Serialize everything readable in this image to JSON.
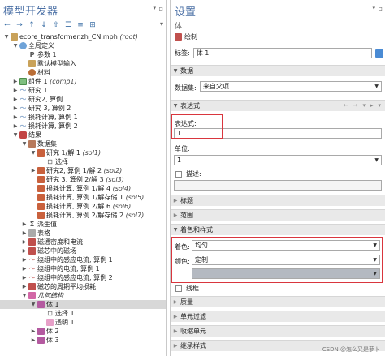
{
  "model_builder": {
    "title": "模型开发器",
    "tree": [
      {
        "label": "ecore_transformer.zh_CN.mph",
        "suffix": "(root)",
        "icon": "file-icon",
        "arrow": "▼",
        "depth": 0
      },
      {
        "label": "全局定义",
        "icon": "globe-icon",
        "arrow": "▼",
        "depth": 1
      },
      {
        "label": "参数 1",
        "icon": "param-icon",
        "arrow": "",
        "depth": 2
      },
      {
        "label": "默认模型输入",
        "icon": "doc-icon",
        "arrow": "",
        "depth": 2
      },
      {
        "label": "材料",
        "icon": "material-icon",
        "arrow": "",
        "depth": 2
      },
      {
        "label": "组件 1",
        "suffix": "(comp1)",
        "icon": "component-icon",
        "arrow": "▶",
        "depth": 1
      },
      {
        "label": "研究 1",
        "icon": "study-icon",
        "arrow": "▶",
        "depth": 1
      },
      {
        "label": "研究2, 算例 1",
        "icon": "study-icon",
        "arrow": "▶",
        "depth": 1
      },
      {
        "label": "研究 3, 算例 2",
        "icon": "study-icon",
        "arrow": "▶",
        "depth": 1
      },
      {
        "label": "损耗计算, 算例 1",
        "icon": "study-icon",
        "arrow": "▶",
        "depth": 1
      },
      {
        "label": "损耗计算, 算例 2",
        "icon": "study-icon",
        "arrow": "▶",
        "depth": 1
      },
      {
        "label": "结果",
        "icon": "results-icon",
        "arrow": "▼",
        "depth": 1
      },
      {
        "label": "数据集",
        "icon": "dataset-folder-icon",
        "arrow": "▼",
        "depth": 2
      },
      {
        "label": "研究 1/解 1",
        "suffix": "(sol1)",
        "icon": "dataset-icon",
        "arrow": "▼",
        "depth": 3
      },
      {
        "label": "选择",
        "icon": "selection-icon",
        "arrow": "",
        "depth": 4
      },
      {
        "label": "研究2, 算例 1/解 2",
        "suffix": "(sol2)",
        "icon": "dataset-icon",
        "arrow": "▶",
        "depth": 3
      },
      {
        "label": "研究 3, 算例 2/解 3",
        "suffix": "(sol3)",
        "icon": "dataset-icon",
        "arrow": "",
        "depth": 3
      },
      {
        "label": "损耗计算, 算例 1/解 4",
        "suffix": "(sol4)",
        "icon": "dataset-icon",
        "arrow": "",
        "depth": 3
      },
      {
        "label": "损耗计算, 算例 1/解存储 1",
        "suffix": "(sol5)",
        "icon": "dataset-icon",
        "arrow": "",
        "depth": 3
      },
      {
        "label": "损耗计算, 算例 2/解 6",
        "suffix": "(sol6)",
        "icon": "dataset-icon",
        "arrow": "",
        "depth": 3
      },
      {
        "label": "损耗计算, 算例 2/解存储 2",
        "suffix": "(sol7)",
        "icon": "dataset-icon",
        "arrow": "",
        "depth": 3
      },
      {
        "label": "派生值",
        "icon": "derived-values-icon",
        "arrow": "▶",
        "depth": 2
      },
      {
        "label": "表格",
        "icon": "table-icon",
        "arrow": "▶",
        "depth": 2
      },
      {
        "label": "磁通密度和电流",
        "icon": "plot-group-icon",
        "arrow": "▶",
        "depth": 2
      },
      {
        "label": "磁芯中的磁场",
        "icon": "plot-group-icon",
        "arrow": "▶",
        "depth": 2
      },
      {
        "label": "绕组中的感应电流, 算例 1",
        "icon": "curve-plot-icon",
        "arrow": "▶",
        "depth": 2
      },
      {
        "label": "绕组中的电流, 算例 1",
        "icon": "curve-plot-icon",
        "arrow": "▶",
        "depth": 2
      },
      {
        "label": "绕组中的感应电流, 算例 2",
        "icon": "curve-plot-icon",
        "arrow": "▶",
        "depth": 2
      },
      {
        "label": "磁芯的周期平均损耗",
        "icon": "plot-group-icon",
        "arrow": "▶",
        "depth": 2
      },
      {
        "label": "几何结构",
        "icon": "geometry-plot-icon",
        "arrow": "▼",
        "depth": 2,
        "italic": true
      },
      {
        "label": "体 1",
        "icon": "volume-icon",
        "arrow": "▼",
        "depth": 3,
        "selected": true
      },
      {
        "label": "选择 1",
        "icon": "selection-icon",
        "arrow": "",
        "depth": 4
      },
      {
        "label": "透明 1",
        "icon": "transparency-icon",
        "arrow": "",
        "depth": 4
      },
      {
        "label": "体 2",
        "icon": "volume-icon",
        "arrow": "▶",
        "depth": 3
      },
      {
        "label": "体 3",
        "icon": "volume-icon",
        "arrow": "▶",
        "depth": 3
      }
    ]
  },
  "settings": {
    "title": "设置",
    "subtitle": "体",
    "plot_button": "绘制",
    "label_field": {
      "label": "标签:",
      "value": "体 1"
    },
    "data_section": {
      "title": "数据",
      "dataset_label": "数据集:",
      "dataset_value": "来自父项"
    },
    "expression_section": {
      "title": "表达式",
      "expr_label": "表达式:",
      "expr_value": "1",
      "unit_label": "单位:",
      "unit_value": "1",
      "description_label": "描述:"
    },
    "collapsed_sections": [
      "标题",
      "范围"
    ],
    "coloring_section": {
      "title": "着色和样式",
      "coloring_label": "着色:",
      "coloring_value": "均匀",
      "color_label": "颜色:",
      "color_value": "定制",
      "wireframe_label": "线框"
    },
    "bottom_sections": [
      "质量",
      "单元过滤",
      "收缩单元",
      "继承样式"
    ],
    "watermark": "CSDN @怎么又是萝卜",
    "highlight_color": "#d9363e"
  }
}
